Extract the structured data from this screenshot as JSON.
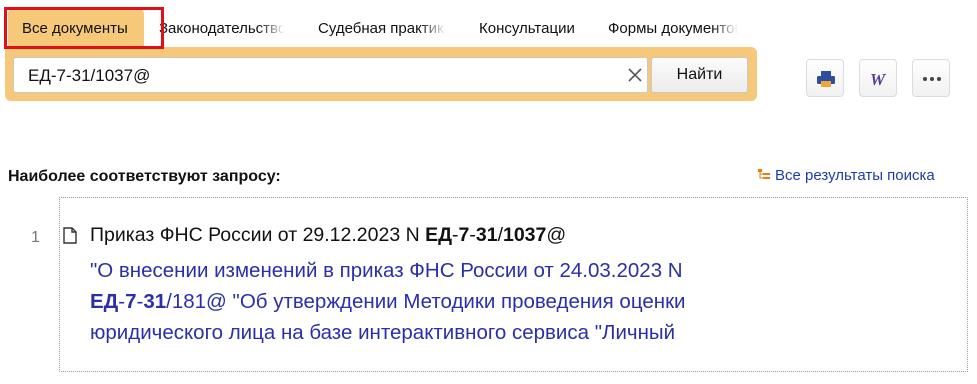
{
  "tabs": [
    {
      "label": "Все документы",
      "active": true
    },
    {
      "label": "Законодательство",
      "active": false
    },
    {
      "label": "Судебная практика",
      "active": false
    },
    {
      "label": "Консультации",
      "active": false
    },
    {
      "label": "Формы документов",
      "active": false
    }
  ],
  "search": {
    "value": "ЕД-7-31/1037@",
    "find_label": "Найти",
    "clear_icon": "close-icon"
  },
  "toolbar": {
    "print_icon": "printer-icon",
    "word_icon": "word-export-icon",
    "more_icon": "more-dots-icon"
  },
  "results": {
    "heading": "Наиболее соответствуют запросу:",
    "all_results_label": "Все результаты поиска",
    "items": [
      {
        "number": "1",
        "title_prefix": "Приказ ФНС России от 29.12.2023 N ",
        "title_code_1": "ЕД",
        "title_dash_1": "-",
        "title_code_2": "7",
        "title_dash_2": "-",
        "title_code_3": "31",
        "title_slash": "/",
        "title_code_4": "1037",
        "title_suffix": "@",
        "desc_line1": "\"О внесении изменений в приказ ФНС России от 24.03.2023 N",
        "desc_line2_code_1": "ЕД",
        "desc_line2_dash_1": "-",
        "desc_line2_code_2": "7",
        "desc_line2_dash_2": "-",
        "desc_line2_code_3": "31",
        "desc_line2_rest": "/181@ \"Об утверждении Методики проведения оценки",
        "desc_line3": "юридического лица на базе интерактивного сервиса \"Личный"
      }
    ]
  },
  "colors": {
    "accent": "#f6c87a",
    "highlight_border": "#e0101a",
    "link": "#2b2fa8"
  }
}
